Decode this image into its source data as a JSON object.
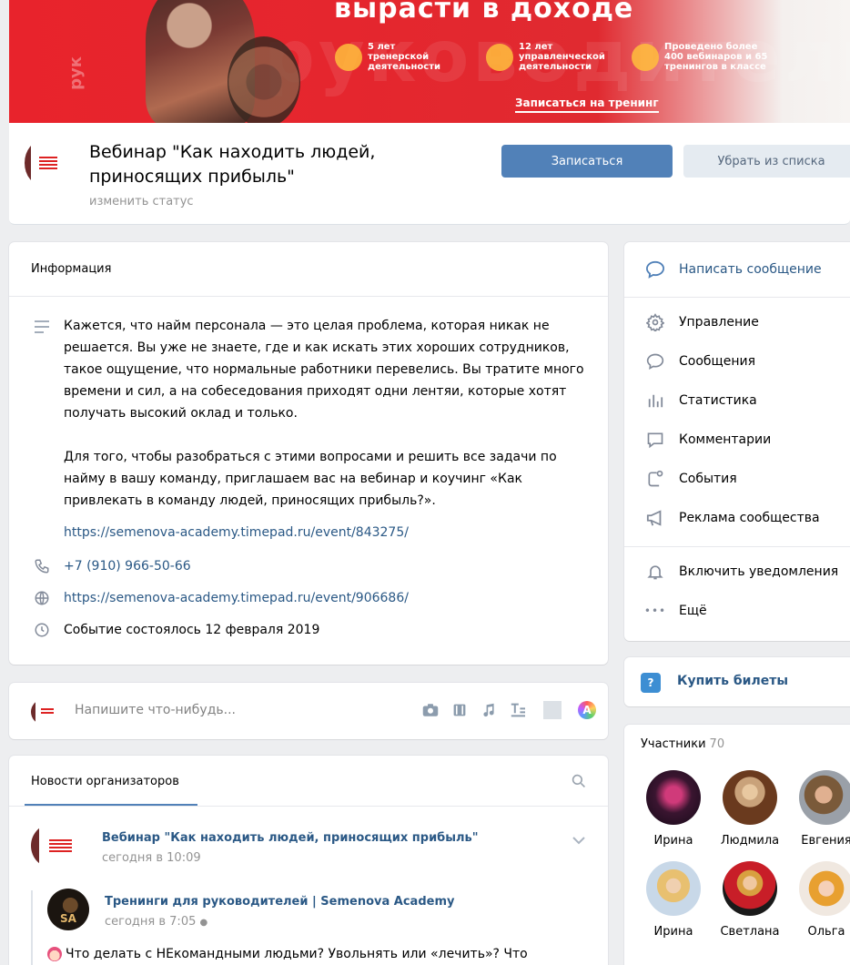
{
  "cover": {
    "headline": "вырасти в доходе",
    "watermark": "руководитель",
    "side_text": "рук",
    "features": [
      "5 лет тренерской деятельности",
      "12 лет управленческой деятельности",
      "Проведено более 400 вебинаров и 65 тренингов в классе"
    ],
    "cta": "Записаться на тренинг"
  },
  "header": {
    "title": "Вебинар \"Как находить людей, приносящих прибыль\"",
    "status": "изменить статус",
    "join_button": "Записаться",
    "remove_button": "Убрать из списка"
  },
  "info": {
    "title": "Информация",
    "description": "Кажется, что найм персонала — это целая проблема, которая никак не решается. Вы уже не знаете, где и как искать этих хороших сотрудников, такое ощущение, что нормальные работники перевелись. Вы тратите много времени и сил, а на собеседования приходят одни лентяи, которые хотят получать высокий оклад и только.\n\nДля того, чтобы разобраться с этими вопросами и решить все задачи по найму в вашу команду, приглашаем вас на вебинар и коучинг «Как привлекать в команду людей, приносящих прибыль?».",
    "desc_link": "https://semenova-academy.timepad.ru/event/843275/",
    "phone": "+7 (910) 966-50-66",
    "site": "https://semenova-academy.timepad.ru/event/906686/",
    "event_date": "Событие состоялось 12 февраля 2019"
  },
  "postbox": {
    "placeholder": "Напишите что-нибудь...",
    "avatar_letter": "A"
  },
  "news": {
    "tab": "Новости организаторов",
    "post_author": "Вебинар \"Как находить людей, приносящих прибыль\"",
    "post_time": "сегодня в 10:09",
    "repost_author": "Тренинги для руководителей | Semenova Academy",
    "repost_time": "сегодня в 7:05",
    "repost_avatar_text": "SA",
    "repost_text": "Что делать с НЕкомандными людьми? Увольнять или «лечить»? Что"
  },
  "menu": {
    "write_message": "Написать сообщение",
    "items": [
      "Управление",
      "Сообщения",
      "Статистика",
      "Комментарии",
      "События",
      "Реклама сообщества"
    ],
    "notifications": "Включить уведомления",
    "more": "Ещё"
  },
  "tickets": {
    "label": "Купить билеты",
    "icon_letter": "?"
  },
  "members": {
    "title": "Участники",
    "count": "70",
    "list": [
      "Ирина",
      "Людмила",
      "Евгения",
      "Ирина",
      "Светлана",
      "Ольга"
    ]
  }
}
